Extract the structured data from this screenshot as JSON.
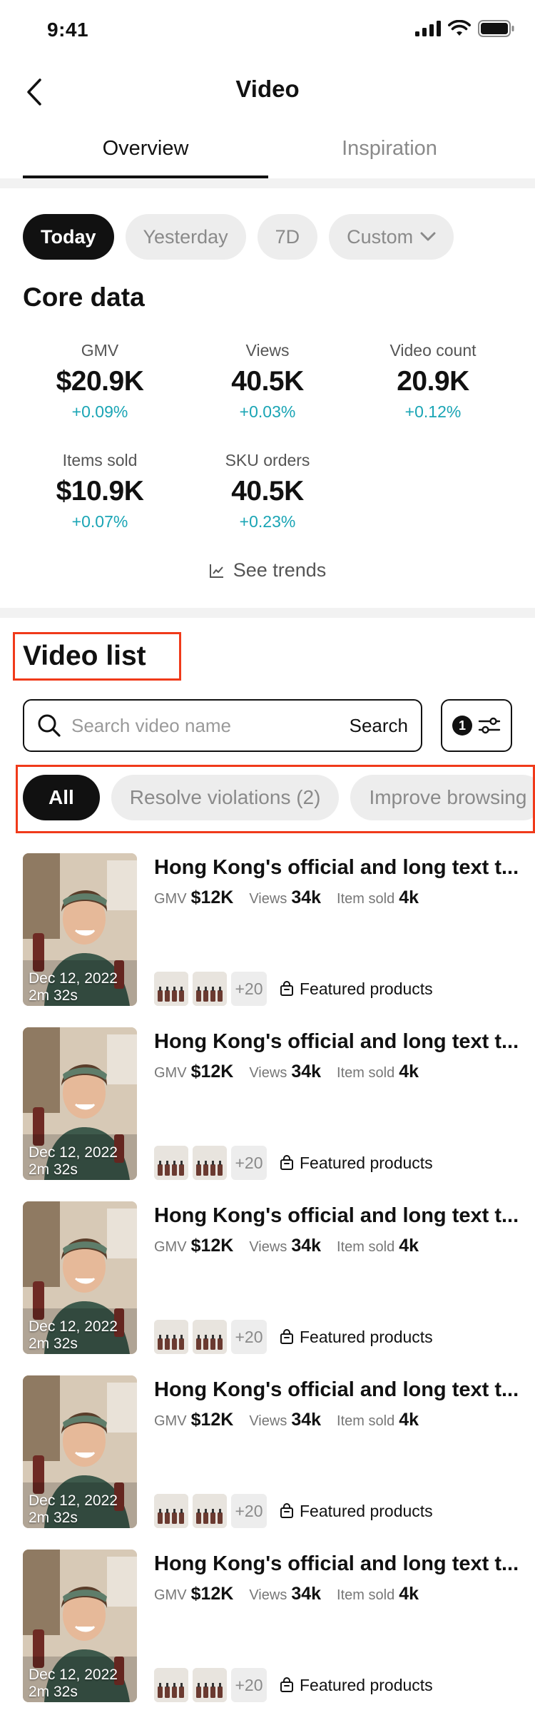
{
  "status_bar": {
    "time": "9:41"
  },
  "header": {
    "title": "Video"
  },
  "tabs": [
    {
      "label": "Overview",
      "active": true
    },
    {
      "label": "Inspiration",
      "active": false
    }
  ],
  "date_filters": [
    {
      "label": "Today",
      "active": true
    },
    {
      "label": "Yesterday",
      "active": false
    },
    {
      "label": "7D",
      "active": false
    },
    {
      "label": "Custom",
      "active": false
    }
  ],
  "core_data": {
    "title": "Core data",
    "metrics": [
      {
        "label": "GMV",
        "value": "$20.9K",
        "change": "+0.09%"
      },
      {
        "label": "Views",
        "value": "40.5K",
        "change": "+0.03%"
      },
      {
        "label": "Video count",
        "value": "20.9K",
        "change": "+0.12%"
      },
      {
        "label": "Items sold",
        "value": "$10.9K",
        "change": "+0.07%"
      },
      {
        "label": "SKU orders",
        "value": "40.5K",
        "change": "+0.23%"
      }
    ],
    "see_trends": "See trends"
  },
  "video_list": {
    "title": "Video list",
    "search": {
      "placeholder": "Search video name",
      "button": "Search"
    },
    "filter_count": "1",
    "filters": [
      {
        "label": "All",
        "active": true
      },
      {
        "label": "Resolve violations (2)",
        "active": false
      },
      {
        "label": "Improve browsing",
        "active": false
      }
    ],
    "items": [
      {
        "title": "Hong Kong's official and long text t...",
        "date": "Dec 12, 2022",
        "duration": "2m 32s",
        "gmv_label": "GMV",
        "gmv": "$12K",
        "views_label": "Views",
        "views": "34k",
        "sold_label": "Item sold",
        "sold": "4k",
        "more_products": "+20",
        "featured": "Featured products"
      },
      {
        "title": "Hong Kong's official and long text t...",
        "date": "Dec 12, 2022",
        "duration": "2m 32s",
        "gmv_label": "GMV",
        "gmv": "$12K",
        "views_label": "Views",
        "views": "34k",
        "sold_label": "Item sold",
        "sold": "4k",
        "more_products": "+20",
        "featured": "Featured products"
      },
      {
        "title": "Hong Kong's official and long text t...",
        "date": "Dec 12, 2022",
        "duration": "2m 32s",
        "gmv_label": "GMV",
        "gmv": "$12K",
        "views_label": "Views",
        "views": "34k",
        "sold_label": "Item sold",
        "sold": "4k",
        "more_products": "+20",
        "featured": "Featured products"
      },
      {
        "title": "Hong Kong's official and long text t...",
        "date": "Dec 12, 2022",
        "duration": "2m 32s",
        "gmv_label": "GMV",
        "gmv": "$12K",
        "views_label": "Views",
        "views": "34k",
        "sold_label": "Item sold",
        "sold": "4k",
        "more_products": "+20",
        "featured": "Featured products"
      },
      {
        "title": "Hong Kong's official and long text t...",
        "date": "Dec 12, 2022",
        "duration": "2m 32s",
        "gmv_label": "GMV",
        "gmv": "$12K",
        "views_label": "Views",
        "views": "34k",
        "sold_label": "Item sold",
        "sold": "4k",
        "more_products": "+20",
        "featured": "Featured products"
      }
    ]
  },
  "colors": {
    "accent_change": "#1aa5b5",
    "annotation": "#f03a1a",
    "primary": "#111111"
  }
}
